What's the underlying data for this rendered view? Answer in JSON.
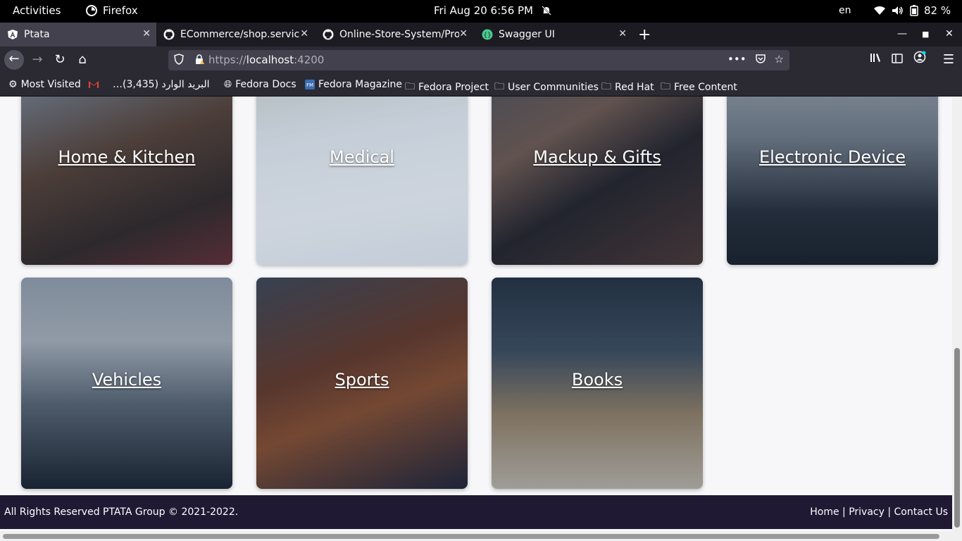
{
  "gnome": {
    "activities": "Activities",
    "app_name": "Firefox",
    "clock": "Fri Aug 20   6:56 PM",
    "lang": "en",
    "battery": "82 %"
  },
  "tabs": [
    {
      "title": "Ptata",
      "icon": "angular-icon",
      "active": true
    },
    {
      "title": "ECommerce/shop.service",
      "icon": "github-icon",
      "active": false
    },
    {
      "title": "Online-Store-System/Pro",
      "icon": "github-icon",
      "active": false
    },
    {
      "title": "Swagger UI",
      "icon": "swagger-icon",
      "active": false
    }
  ],
  "urlbar": {
    "url_prefix": "https://",
    "url_host": "localhost",
    "url_port": ":4200"
  },
  "bookmarks": {
    "most_visited": "Most Visited",
    "gmail": "…البريد الوارد (3,435)",
    "fedora_docs": "Fedora Docs",
    "fedora_magazine": "Fedora Magazine",
    "fedora_project": "Fedora Project",
    "user_communities": "User Communities",
    "red_hat": "Red Hat",
    "free_content": "Free Content"
  },
  "categories": [
    {
      "label": "Home & Kitchen",
      "theme": "home"
    },
    {
      "label": "Medical",
      "theme": "medical"
    },
    {
      "label": "Mackup & Gifts",
      "theme": "makeup"
    },
    {
      "label": "Electronic Device",
      "theme": "electronics"
    },
    {
      "label": "Vehicles",
      "theme": "vehicles"
    },
    {
      "label": "Sports",
      "theme": "sports"
    },
    {
      "label": "Books",
      "theme": "books"
    }
  ],
  "footer": {
    "copyright": "All Rights Reserved PTATA Group © 2021-2022.",
    "home": "Home",
    "privacy": "Privacy",
    "contact": "Contact Us",
    "sep": " | "
  }
}
